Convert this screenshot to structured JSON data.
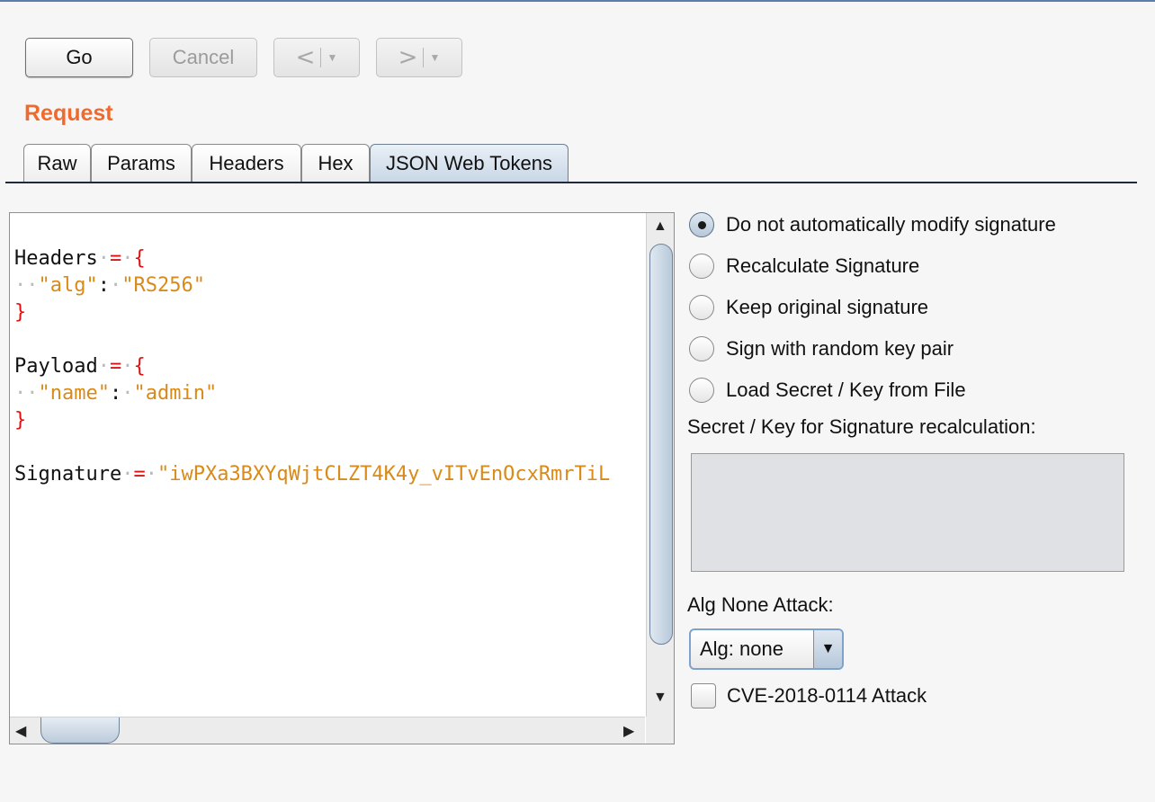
{
  "toolbar": {
    "go_label": "Go",
    "cancel_label": "Cancel",
    "back_glyph": "<",
    "forward_glyph": ">",
    "dropdown_glyph": "▼"
  },
  "request": {
    "title": "Request",
    "tabs": [
      {
        "label": "Raw",
        "active": false
      },
      {
        "label": "Params",
        "active": false
      },
      {
        "label": "Headers",
        "active": false
      },
      {
        "label": "Hex",
        "active": false
      },
      {
        "label": "JSON Web Tokens",
        "active": true
      }
    ]
  },
  "editor": {
    "headers_key": "Headers",
    "alg_key": "\"alg\"",
    "alg_value": "\"RS256\"",
    "payload_key": "Payload",
    "name_key": "\"name\"",
    "name_value": "\"admin\"",
    "signature_key": "Signature",
    "signature_value": "\"iwPXa3BXYqWjtCLZT4K4y_vITvEnOcxRmrTiL",
    "equals": "=",
    "open_brace": "{",
    "close_brace": "}",
    "colon": ":",
    "indent_dots": "··",
    "space_dot": "·"
  },
  "signature_options": {
    "options": [
      {
        "label": "Do not automatically modify signature",
        "checked": true
      },
      {
        "label": "Recalculate Signature",
        "checked": false
      },
      {
        "label": "Keep original signature",
        "checked": false
      },
      {
        "label": "Sign with random key pair",
        "checked": false
      },
      {
        "label": "Load Secret / Key from File",
        "checked": false
      }
    ],
    "secret_label": "Secret / Key for Signature recalculation:",
    "secret_value": "",
    "alg_none_label": "Alg None Attack:",
    "alg_select_value": "Alg: none",
    "cve_label": "CVE-2018-0114 Attack",
    "cve_checked": false
  },
  "colors": {
    "request_title": "#f06a2d",
    "string": "#d98a18",
    "operator": "#dd1111",
    "active_tab": "#c9d7e6"
  }
}
